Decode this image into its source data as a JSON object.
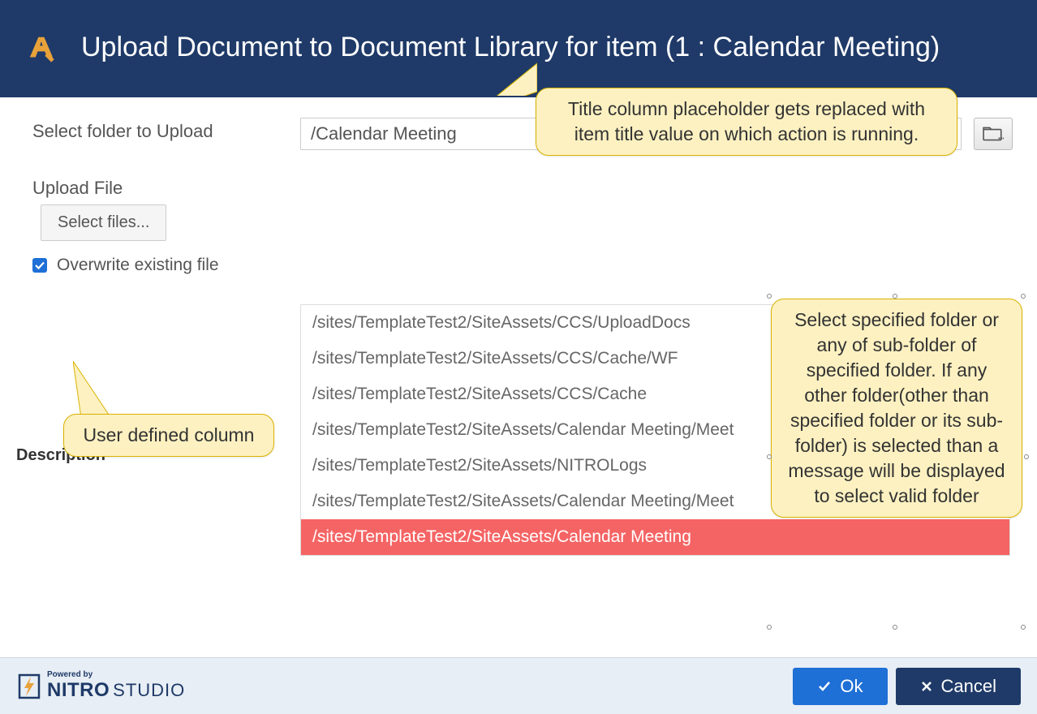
{
  "header": {
    "title": "Upload Document to Document Library for item (1 : Calendar Meeting)"
  },
  "form": {
    "folder_label": "Select folder to Upload",
    "folder_value": "/Calendar Meeting",
    "upload_label": "Upload File",
    "select_files": "Select files...",
    "overwrite_label": "Overwrite existing file",
    "overwrite_checked": true,
    "description_label": "Description"
  },
  "dropdown": {
    "items": [
      "/sites/TemplateTest2/SiteAssets/CCS/UploadDocs",
      "/sites/TemplateTest2/SiteAssets/CCS/Cache/WF",
      "/sites/TemplateTest2/SiteAssets/CCS/Cache",
      "/sites/TemplateTest2/SiteAssets/Calendar Meeting/Meet",
      "/sites/TemplateTest2/SiteAssets/NITROLogs",
      "/sites/TemplateTest2/SiteAssets/Calendar Meeting/Meet",
      "/sites/TemplateTest2/SiteAssets/Calendar Meeting"
    ],
    "selected_index": 6
  },
  "callouts": {
    "top": "Title column placeholder gets replaced with item title value on which action is running.",
    "left": "User defined column",
    "right": "Select specified folder or any of sub-folder of specified folder. If any other folder(other than specified folder or its sub-folder) is selected than a message will be displayed to select valid folder"
  },
  "footer": {
    "powered_by": "Powered by",
    "brand1": "NITRO",
    "brand2": "STUDIO",
    "ok": "Ok",
    "cancel": "Cancel"
  }
}
